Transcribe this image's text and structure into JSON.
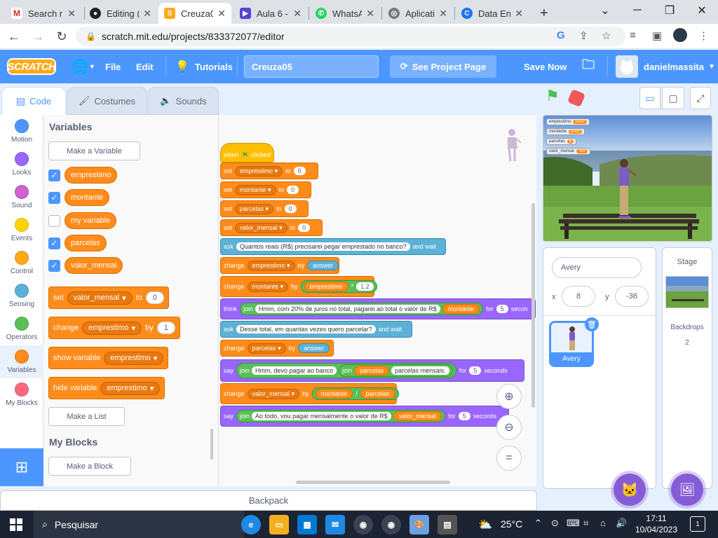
{
  "browser": {
    "tabs": [
      {
        "label": "Search r",
        "icon": "gmail-icon"
      },
      {
        "label": "Editing (",
        "icon": "github-icon"
      },
      {
        "label": "Creuza0",
        "icon": "scratch-icon"
      },
      {
        "label": "Aula 6 -",
        "icon": "twitch-icon"
      },
      {
        "label": "WhatsA",
        "icon": "whatsapp-icon"
      },
      {
        "label": "Aplicati",
        "icon": "globe-icon"
      },
      {
        "label": "Data En",
        "icon": "google-icon"
      }
    ],
    "url": "scratch.mit.edu/projects/833372077/editor"
  },
  "menubar": {
    "logo": "SCRATCH",
    "file": "File",
    "edit": "Edit",
    "tutorials": "Tutorials",
    "project_title": "Creuza05",
    "see_project_page": "See Project Page",
    "save_now": "Save Now",
    "username": "danielmassita"
  },
  "editor_tabs": {
    "code": "Code",
    "costumes": "Costumes",
    "sounds": "Sounds"
  },
  "categories": [
    {
      "label": "Motion",
      "color": "#4c97ff"
    },
    {
      "label": "Looks",
      "color": "#9966ff"
    },
    {
      "label": "Sound",
      "color": "#cf63cf"
    },
    {
      "label": "Events",
      "color": "#ffd500"
    },
    {
      "label": "Control",
      "color": "#ffab19"
    },
    {
      "label": "Sensing",
      "color": "#5cb1d6"
    },
    {
      "label": "Operators",
      "color": "#59c059"
    },
    {
      "label": "Variables",
      "color": "#ff8c1a"
    },
    {
      "label": "My Blocks",
      "color": "#ff6680"
    }
  ],
  "palette": {
    "heading": "Variables",
    "make_variable": "Make a Variable",
    "variables": [
      {
        "name": "emprestimo",
        "checked": true
      },
      {
        "name": "montante",
        "checked": true
      },
      {
        "name": "my variable",
        "checked": false
      },
      {
        "name": "parcelas",
        "checked": true
      },
      {
        "name": "valor_mensal",
        "checked": true
      }
    ],
    "set_block": {
      "label": "set",
      "var": "valor_mensal",
      "to": "to",
      "value": "0"
    },
    "change_block": {
      "label": "change",
      "var": "emprestimo",
      "by": "by",
      "value": "1"
    },
    "show_block": {
      "label": "show variable",
      "var": "emprestimo"
    },
    "hide_block": {
      "label": "hide variable",
      "var": "emprestimo"
    },
    "make_list": "Make a List",
    "my_blocks_heading": "My Blocks",
    "make_block": "Make a Block"
  },
  "script": {
    "hat": {
      "when": "when",
      "clicked": "clicked"
    },
    "set1": {
      "op": "set",
      "var": "emprestimo",
      "to": "to",
      "val": "0"
    },
    "set2": {
      "op": "set",
      "var": "montante",
      "to": "to",
      "val": "0"
    },
    "set3": {
      "op": "set",
      "var": "parcelas",
      "to": "to",
      "val": "0"
    },
    "set4": {
      "op": "set",
      "var": "valor_mensal",
      "to": "to",
      "val": "0"
    },
    "ask1": {
      "op": "ask",
      "text": "Quantos reais (R$) precisarei pegar emprestado no banco?",
      "wait": "and wait"
    },
    "change1": {
      "op": "change",
      "var": "emprestimo",
      "by": "by",
      "answer": "answer"
    },
    "change2": {
      "op": "change",
      "var": "montante",
      "by": "by",
      "reporter": "emprestimo",
      "times": "*",
      "val": "1.2"
    },
    "think1": {
      "op": "think",
      "join": "join",
      "text": "Hmm, com 20% de juros no total, pagarei ao total o valor de R$",
      "reporter": "montante",
      "for": "for",
      "secs": "5",
      "seconds": "secon"
    },
    "ask2": {
      "op": "ask",
      "text": "Desse total, em quantas vezes quero parcelar?",
      "wait": "and wait"
    },
    "change3": {
      "op": "change",
      "var": "parcelas",
      "by": "by",
      "answer": "answer"
    },
    "say1": {
      "op": "say",
      "join": "join",
      "text": "Hmm, devo pagar ao banco",
      "join2": "join",
      "reporter": "parcelas",
      "text2": "parcelas mensais.",
      "for": "for",
      "secs": "5",
      "seconds": "seconds"
    },
    "change4": {
      "op": "change",
      "var": "valor_mensal",
      "by": "by",
      "reporter1": "montante",
      "div": "/",
      "reporter2": "parcelas"
    },
    "say2": {
      "op": "say",
      "join": "join",
      "text": "Ao todo, vou pagar mensalmente o valor de R$",
      "reporter": "valor_mensal",
      "for": "for",
      "secs": "5",
      "seconds": "seconds"
    }
  },
  "stage": {
    "monitors": [
      {
        "name": "emprestimo",
        "value": "5000"
      },
      {
        "name": "montante",
        "value": "6000"
      },
      {
        "name": "parcelas",
        "value": "8"
      },
      {
        "name": "valor_mensal",
        "value": "750"
      }
    ]
  },
  "sprite_info": {
    "name": "Avery",
    "x_label": "x",
    "x": "8",
    "y_label": "y",
    "y": "-36",
    "sprite_tile_label": "Avery"
  },
  "stage_pane": {
    "title": "Stage",
    "backdrops_label": "Backdrops",
    "backdrops_count": "2"
  },
  "backpack": "Backpack",
  "taskbar": {
    "search": "Pesquisar",
    "temp": "25°C",
    "time": "17:11",
    "date": "10/04/2023",
    "notifications": "1"
  }
}
